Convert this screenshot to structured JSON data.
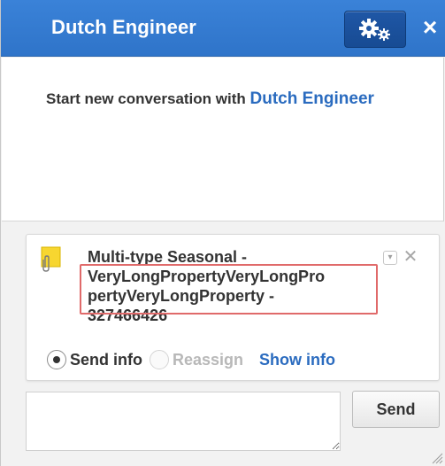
{
  "header": {
    "title": "Dutch Engineer",
    "settings_icon": "gears-icon",
    "close_label": "×"
  },
  "panel": {
    "start_prefix": "Start new conversation with",
    "start_link": "Dutch Engineer"
  },
  "card": {
    "title": "Multi-type Seasonal -\nVeryLongPropertyVeryLongPro\npertyVeryLongProperty -\n327466426",
    "dropdown_glyph": "▾",
    "delete_glyph": "✕"
  },
  "options": {
    "send_info": "Send info",
    "reassign": "Reassign",
    "show_info": "Show info"
  },
  "compose": {
    "placeholder": "",
    "send_label": "Send"
  },
  "colors": {
    "header": "#2f74c9",
    "link": "#2a6bbf",
    "highlight": "#e06a6a",
    "sticky_note": "#f7d630"
  }
}
